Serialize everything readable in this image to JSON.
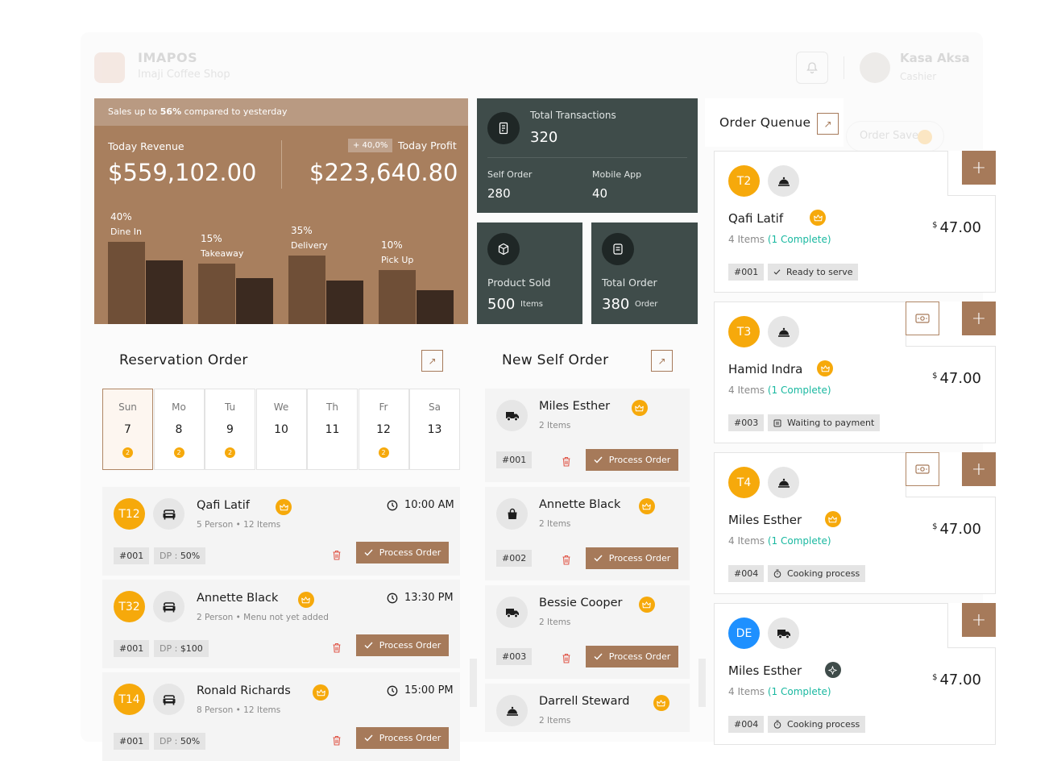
{
  "header": {
    "brand": "IMAPOS",
    "shop": "Imaji Coffee Shop",
    "user_name": "Kasa Aksa",
    "user_role": "Cashier",
    "ghost_label": "Order Saved"
  },
  "revenue": {
    "strip_prefix": "Sales up to ",
    "strip_pct": "56%",
    "strip_suffix": " compared to yesterday",
    "revenue_label": "Today Revenue",
    "revenue_value": "$559,102.00",
    "profit_chip": "+ 40,0%",
    "profit_label": "Today Profit",
    "profit_value": "$223,640.80",
    "channels": [
      {
        "pct": "40%",
        "label": "Dine In",
        "value": 40
      },
      {
        "pct": "15%",
        "label": "Takeaway",
        "value": 15
      },
      {
        "pct": "35%",
        "label": "Delivery",
        "value": 35
      },
      {
        "pct": "10%",
        "label": "Pick Up",
        "value": 10
      }
    ]
  },
  "stats": {
    "transactions_label": "Total Transactions",
    "transactions_value": "320",
    "self_order_label": "Self Order",
    "self_order_value": "280",
    "mobile_label": "Mobile App",
    "mobile_value": "40",
    "product_label": "Product Sold",
    "product_value": "500",
    "product_unit": "Items",
    "order_label": "Total Order",
    "order_value": "380",
    "order_unit": "Order"
  },
  "reservation": {
    "title": "Reservation Order",
    "calendar": [
      {
        "day": "Sun",
        "date": "7",
        "badge": "2",
        "selected": true
      },
      {
        "day": "Mo",
        "date": "8",
        "badge": "2"
      },
      {
        "day": "Tu",
        "date": "9",
        "badge": "2"
      },
      {
        "day": "We",
        "date": "10",
        "badge": ""
      },
      {
        "day": "Th",
        "date": "11",
        "badge": ""
      },
      {
        "day": "Fr",
        "date": "12",
        "badge": "2"
      },
      {
        "day": "Sa",
        "date": "13",
        "badge": ""
      }
    ],
    "orders": [
      {
        "table": "T12",
        "name": "Qafi Latif",
        "persons": "5 Person",
        "items": "12 Items",
        "time": "10:00 AM",
        "id": "#001",
        "dp_label": "DP : ",
        "dp": "50%",
        "button": "Process Order"
      },
      {
        "table": "T32",
        "name": "Annette Black",
        "persons": "2 Person",
        "items": "Menu not yet added",
        "time": "13:30 PM",
        "id": "#001",
        "dp_label": "DP : ",
        "dp": "$100",
        "button": "Process Order"
      },
      {
        "table": "T14",
        "name": "Ronald Richards",
        "persons": "8 Person",
        "items": "12 Items",
        "time": "15:00 PM",
        "id": "#001",
        "dp_label": "DP : ",
        "dp": "50%",
        "button": "Process Order"
      }
    ]
  },
  "self_order": {
    "title": "New Self Order",
    "orders": [
      {
        "name": "Miles Esther",
        "items": "2 Items",
        "id": "#001",
        "button": "Process Order"
      },
      {
        "name": "Annette Black",
        "items": "2 Items",
        "id": "#002",
        "button": "Process Order"
      },
      {
        "name": "Bessie Cooper",
        "items": "2 Items",
        "id": "#003",
        "button": "Process Order"
      },
      {
        "name": "Darrell Steward",
        "items": "2 Items"
      }
    ]
  },
  "queue": {
    "title": "Order Quenue",
    "orders": [
      {
        "table": "T2",
        "name": "Qafi Latif",
        "items": "4 Items",
        "complete": "(1 Complete)",
        "currency": "$",
        "price": "47.00",
        "id": "#001",
        "status": "Ready to serve"
      },
      {
        "table": "T3",
        "name": "Hamid Indra",
        "items": "4 Items",
        "complete": "(1 Complete)",
        "currency": "$",
        "price": "47.00",
        "id": "#003",
        "status": "Waiting to payment"
      },
      {
        "table": "T4",
        "name": "Miles Esther",
        "items": "4 Items",
        "complete": "(1 Complete)",
        "currency": "$",
        "price": "47.00",
        "id": "#004",
        "status": "Cooking process"
      },
      {
        "table": "DE",
        "name": "Miles Esther",
        "items": "4 Items",
        "complete": "(1 Complete)",
        "currency": "$",
        "price": "47.00",
        "id": "#004",
        "status": "Cooking process"
      }
    ]
  },
  "colors": {
    "brown": "#a67a5a",
    "dark_card": "#3f4c4a",
    "orange": "#f6a90b",
    "green": "#19b8a0",
    "blue": "#1e90ff"
  }
}
